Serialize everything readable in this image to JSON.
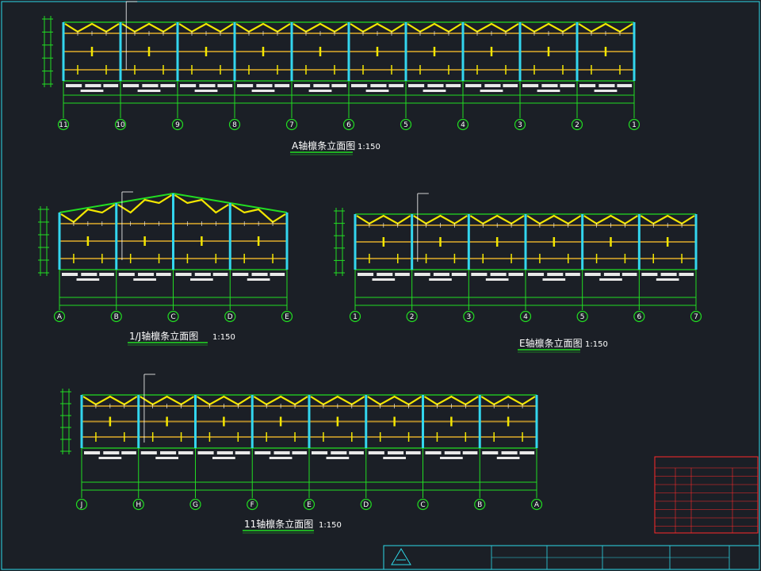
{
  "drawing": {
    "elevations": [
      {
        "id": "elev-a",
        "title": "A轴檩条立面图",
        "scale": "1:150",
        "axes": [
          "11",
          "10",
          "9",
          "8",
          "7",
          "6",
          "5",
          "4",
          "3",
          "2",
          "1"
        ],
        "total_dim": "",
        "mid_label": "",
        "level_top": "",
        "level_bottom": "",
        "roof": "flat"
      },
      {
        "id": "elev-1-j",
        "title": "1/J轴檩条立面图",
        "scale": "1:150",
        "axes": [
          "A",
          "B",
          "C",
          "D",
          "E"
        ],
        "total_dim": "",
        "mid_label": "",
        "level_top": "",
        "level_bottom": "",
        "roof": "gable"
      },
      {
        "id": "elev-e",
        "title": "E轴檩条立面图",
        "scale": "1:150",
        "axes": [
          "1",
          "2",
          "3",
          "4",
          "5",
          "6",
          "7"
        ],
        "total_dim": "",
        "mid_label": "",
        "level_top": "",
        "level_bottom": "",
        "roof": "flat"
      },
      {
        "id": "elev-11",
        "title": "11轴檩条立面图",
        "scale": "1:150",
        "axes": [
          "J",
          "H",
          "G",
          "F",
          "E",
          "D",
          "C",
          "B",
          "A"
        ],
        "total_dim": "",
        "mid_label": "",
        "level_top": "",
        "level_bottom": "",
        "roof": "flat"
      }
    ],
    "colors": {
      "background": "#1b1f26",
      "grid_green": "#22dd22",
      "purlin_yellow": "#f2e600",
      "column_cyan": "#33d6ee",
      "brace_brown": "#b08a2a",
      "text_white": "#ffffff",
      "frame_cyan": "#2ed8e8",
      "legend_red": "#ff2a2a"
    },
    "legend": {
      "title": "",
      "rows": [
        "",
        "",
        "",
        "",
        "",
        "",
        "",
        ""
      ]
    },
    "title_block": {
      "company": "",
      "drawing_name": ""
    }
  }
}
